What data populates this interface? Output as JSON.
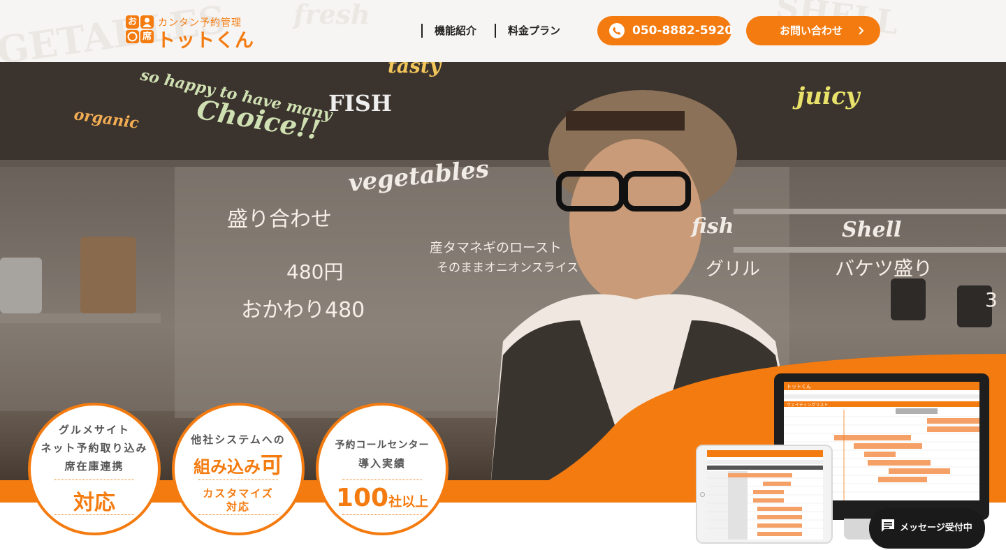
{
  "header": {
    "logo": {
      "tagline": "カンタン予約管理",
      "name": "トットくん",
      "mark_chars": [
        "お",
        "席"
      ]
    },
    "background_words": [
      "GETABLES",
      "fresh",
      "SHELL"
    ],
    "nav": [
      {
        "label": "機能紹介"
      },
      {
        "label": "料金プラン"
      }
    ],
    "phone_button": {
      "number": "050-8882-5920",
      "icon": "phone-icon"
    },
    "contact_button": {
      "label": "お問い合わせ",
      "icon": "chevron-right-icon"
    }
  },
  "hero": {
    "board_words": [
      "organic",
      "so happy to have many",
      "Choice!!",
      "FISH",
      "tasty",
      "juicy",
      "vegetables",
      "fish",
      "Shell",
      "盛り合わせ",
      "480円",
      "おかわり480",
      "グリル",
      "バケツ盛り",
      "3",
      "産タマネギのロースト",
      "そのままオニオンスライス"
    ],
    "orange_accent": "#f47b0f"
  },
  "badges": [
    {
      "lines": [
        "グルメサイト",
        "ネット予約取り込み",
        "席在庫連携"
      ],
      "big": "対応"
    },
    {
      "lines": [
        "他社システムへの"
      ],
      "big": "組み込み",
      "big_emphasis": "可",
      "sub": [
        "カスタマイズ",
        "対応"
      ]
    },
    {
      "lines": [
        "予約コールセンター",
        "導入実績"
      ],
      "big": "100",
      "big_suffix": "社以上"
    }
  ],
  "devices": {
    "monitor_label": "ウェイティングリスト",
    "app_name": "トットくん"
  },
  "chat": {
    "label": "メッセージ受付中",
    "icon": "chat-bubble-icon"
  }
}
